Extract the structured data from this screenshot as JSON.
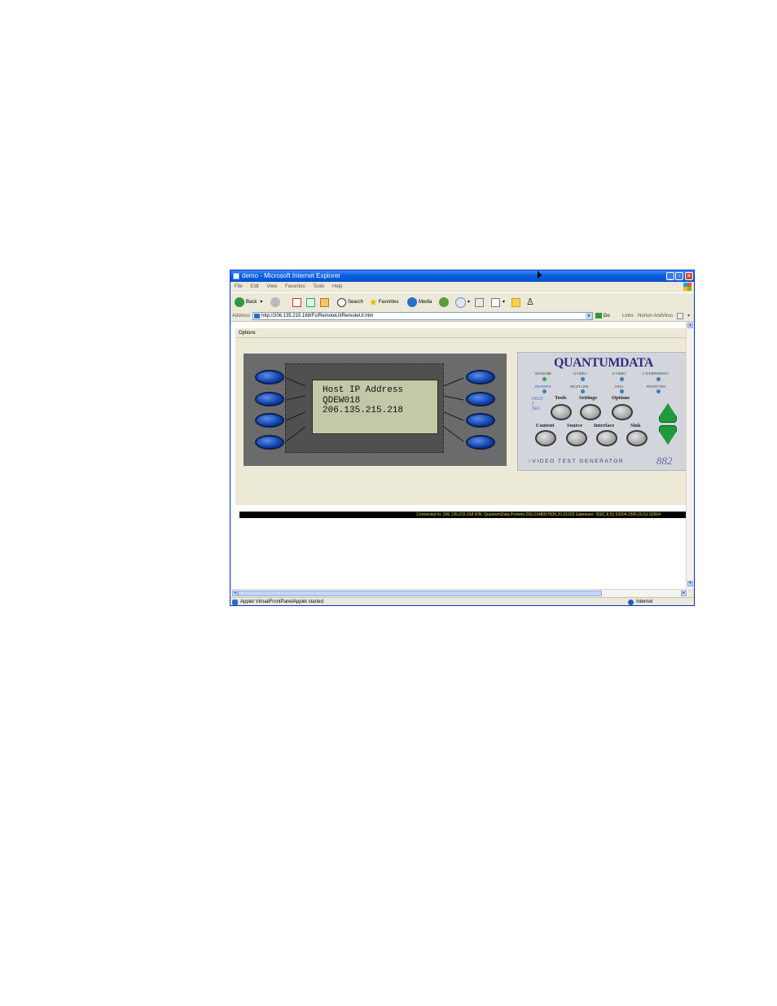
{
  "window": {
    "title": "demo - Microsoft Internet Explorer",
    "minimize": "_",
    "maximize": "▫",
    "close": "×"
  },
  "menu": [
    "File",
    "Edit",
    "View",
    "Favorites",
    "Tools",
    "Help"
  ],
  "toolbar": {
    "back": "Back",
    "search": "Search",
    "favorites": "Favorites",
    "media": "Media"
  },
  "address": {
    "label": "Address",
    "url": "http://206.135.215.168/Fs/RemoteUI/RemoteUI.htm",
    "go": "Go",
    "links": "Links",
    "norton": "Norton AntiVirus"
  },
  "applet": {
    "menu_label": "Options",
    "lcd_lines": [
      "Host IP Address",
      "QDEW018",
      "206.135.215.218"
    ],
    "brand": "QUANTUMDATA",
    "led_labels_row1": [
      "NETWORK",
      "D VIDEO",
      "D VIDEO",
      "C D DIFFERENCE"
    ],
    "led_labels_row2": [
      "BRANDED",
      "MULTI LINK",
      "DATA",
      "PROTECTED"
    ],
    "hold_text": "HOLD 2 SEC",
    "buttons_row1": [
      "Tools",
      "Settings",
      "Options"
    ],
    "buttons_row2": [
      "Content",
      "Source",
      "Interface",
      "Sink"
    ],
    "tagline": "VIDEO TEST GENERATOR",
    "model": "882",
    "status_line": "Connected to: 206.135.215.168   IDN: QuantumData,Proteno:250,2148007836,20.01025   Gateware: 250C,8,51.52004,250F,20,51.52004"
  },
  "statusbar": {
    "text": "Applet VirtualFrontPanelApplet started",
    "zone": "Internet"
  }
}
